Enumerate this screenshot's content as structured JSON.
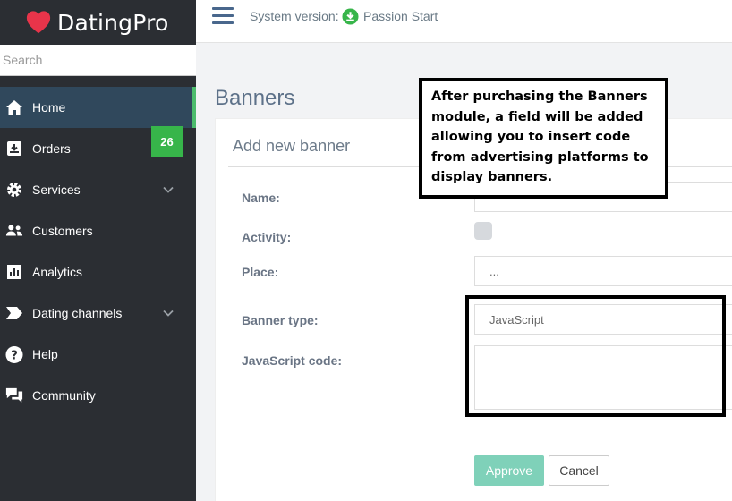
{
  "app": {
    "brand": "DatingPro",
    "brand_color": "#e8344a"
  },
  "search": {
    "placeholder": "Search"
  },
  "sidebar": {
    "items": [
      {
        "label": "Home",
        "icon": "home-icon",
        "active": true
      },
      {
        "label": "Orders",
        "icon": "orders-icon",
        "badge": "26"
      },
      {
        "label": "Services",
        "icon": "gear-icon",
        "expandable": true
      },
      {
        "label": "Customers",
        "icon": "users-icon"
      },
      {
        "label": "Analytics",
        "icon": "chart-icon"
      },
      {
        "label": "Dating channels",
        "icon": "tag-icon",
        "expandable": true
      },
      {
        "label": "Help",
        "icon": "help-icon"
      },
      {
        "label": "Community",
        "icon": "chat-icon"
      }
    ]
  },
  "topbar": {
    "version_label": "System version:",
    "version_name": "Passion Start"
  },
  "page": {
    "title": "Banners"
  },
  "form": {
    "title": "Add new banner",
    "name_label": "Name:",
    "name_value": "",
    "activity_label": "Activity:",
    "activity_checked": false,
    "place_label": "Place:",
    "place_value": "...",
    "type_label": "Banner type:",
    "type_value": "JavaScript",
    "js_label": "JavaScript code:",
    "js_value": "",
    "approve": "Approve",
    "cancel": "Cancel"
  },
  "annotation": {
    "text": "After purchasing the Banners module, a field will be added allowing you to insert code from advertising platforms to display banners."
  },
  "colors": {
    "sidebar_bg": "#2b2e33",
    "active_bg": "#30485c",
    "accent_green": "#37b54a",
    "approve_bg": "#7fd1b9"
  }
}
